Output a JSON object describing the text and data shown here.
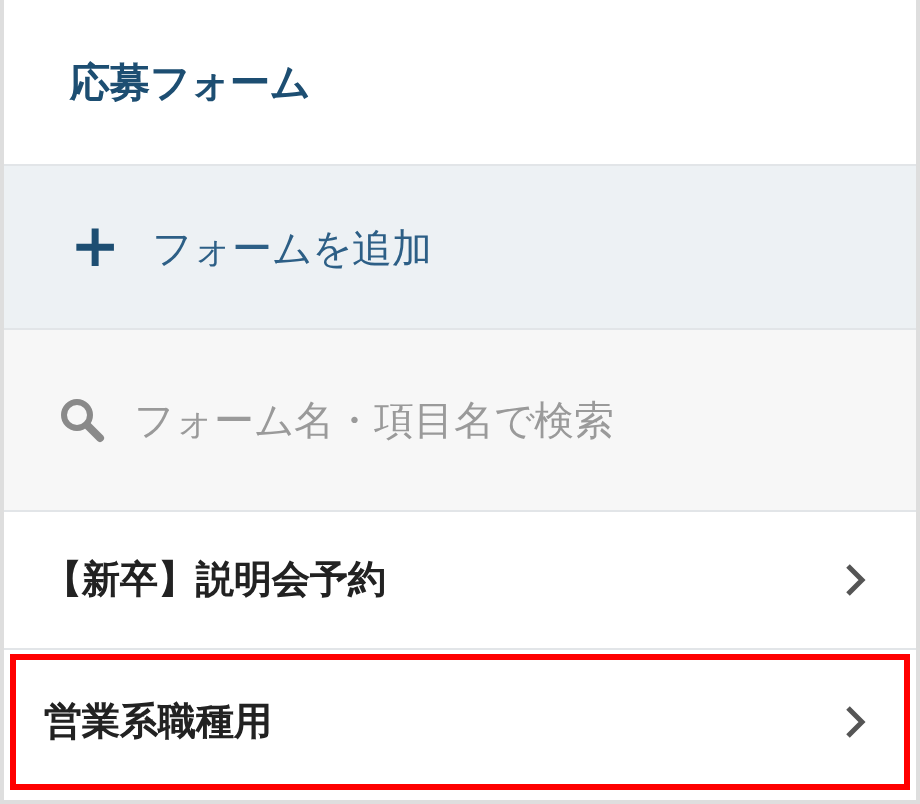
{
  "title": "応募フォーム",
  "add_button": {
    "icon": "+",
    "label": "フォームを追加"
  },
  "search": {
    "placeholder": "フォーム名・項目名で検索"
  },
  "forms": [
    {
      "name": "【新卒】説明会予約",
      "selected": false
    },
    {
      "name": "営業系職種用",
      "selected": true
    }
  ]
}
